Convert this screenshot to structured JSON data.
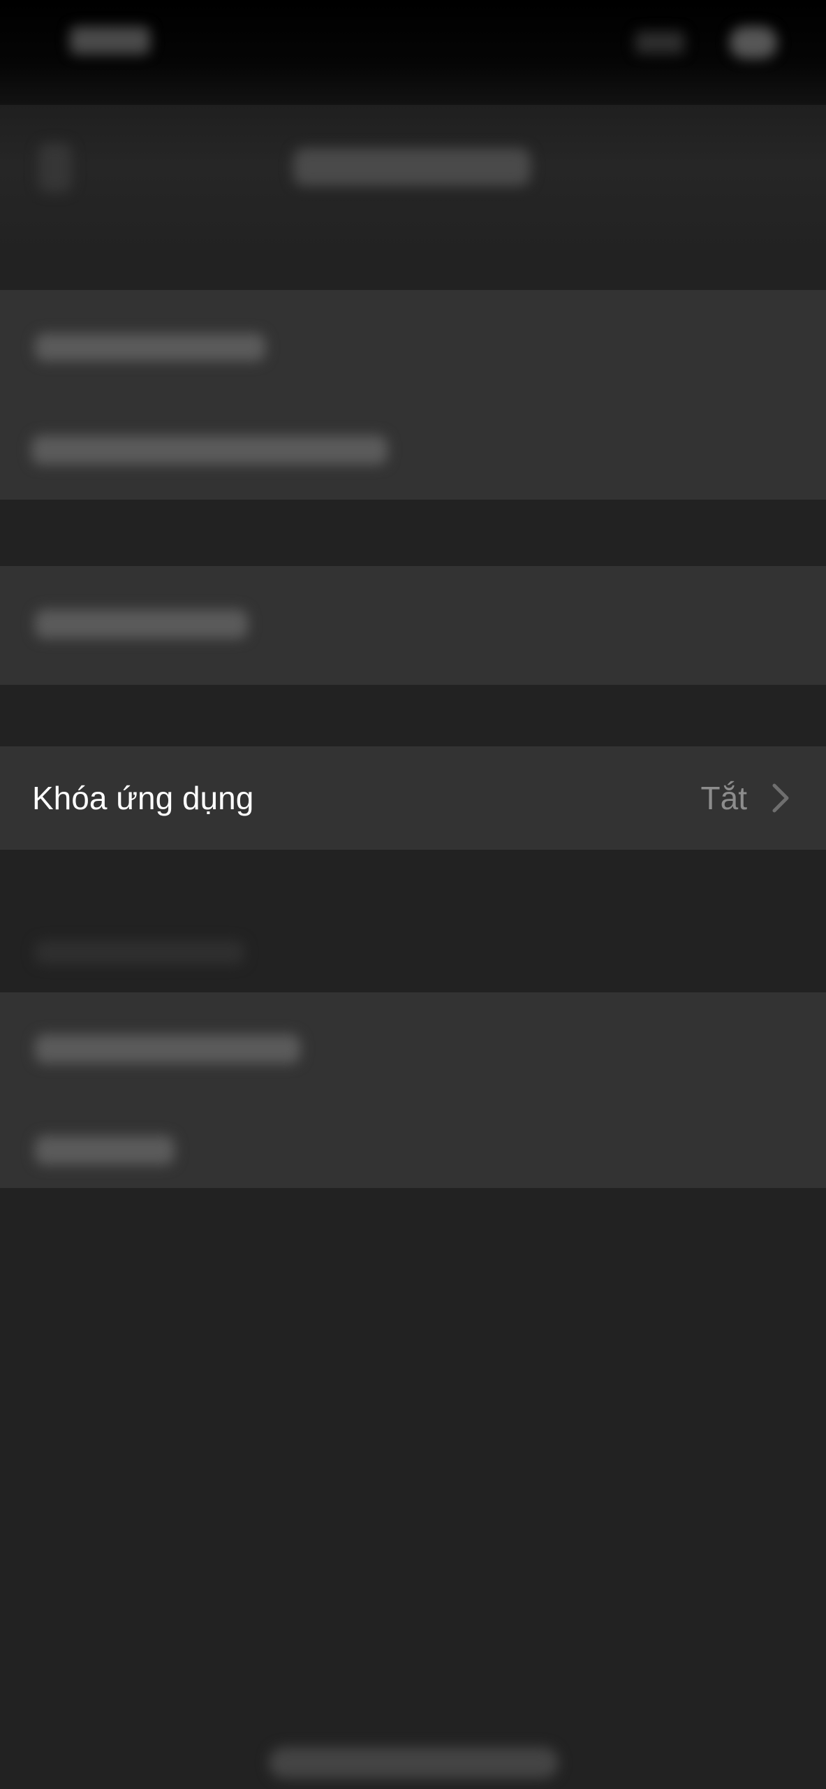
{
  "app_lock_row": {
    "label": "Khóa ứng dụng",
    "value": "Tắt",
    "chevron_icon": "chevron-right-icon"
  },
  "colors": {
    "background": "#222222",
    "row_background": "#333333",
    "label_text": "#ffffff",
    "value_text": "#8d8d8d",
    "chevron": "#6f6f6f"
  }
}
